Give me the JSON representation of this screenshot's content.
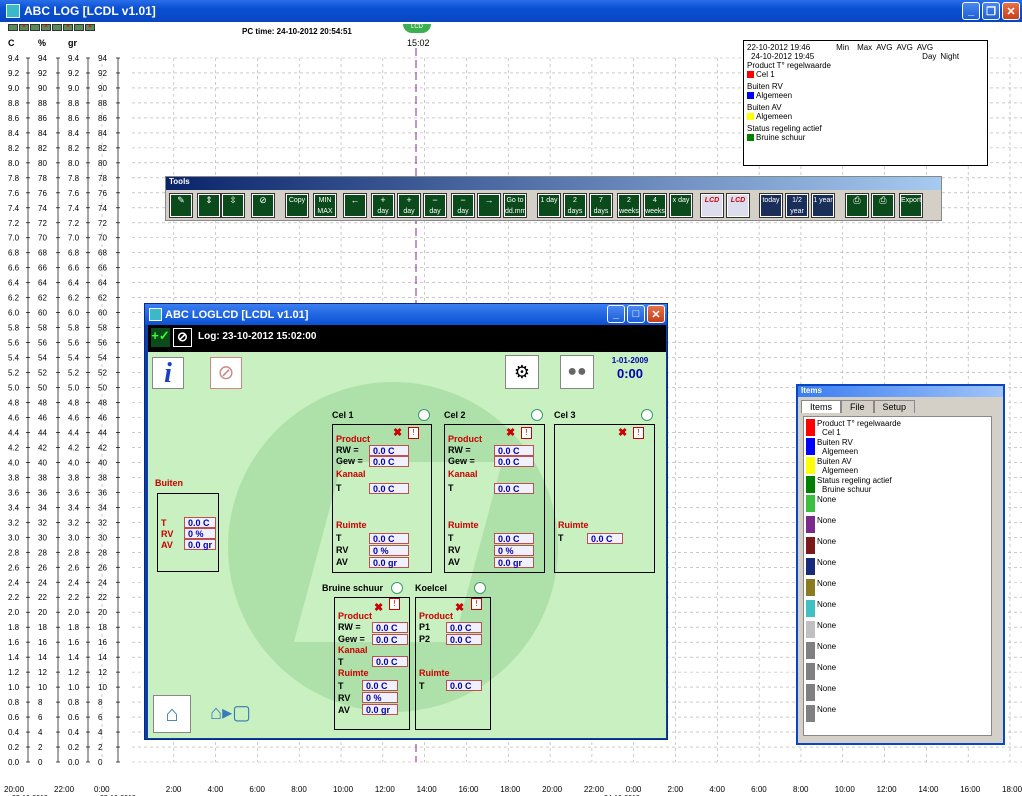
{
  "window": {
    "title": "ABC LOG [LCDL v1.01]"
  },
  "header": {
    "pc_time": "PC time: 24-10-2012 20:54:51",
    "lcd_mark": "LCD",
    "now_time": "15:02"
  },
  "axes": {
    "units": [
      "C",
      "%",
      "gr"
    ]
  },
  "chart_data": {
    "type": "line",
    "left_axes": [
      {
        "unit": "C",
        "ticks": [
          "9.4",
          "9.2",
          "9.0",
          "8.8",
          "8.6",
          "8.4",
          "8.2",
          "8.0",
          "7.8",
          "7.6",
          "7.4",
          "7.2",
          "7.0",
          "6.8",
          "6.6",
          "6.4",
          "6.2",
          "6.0",
          "5.8",
          "5.6",
          "5.4",
          "5.2",
          "5.0",
          "4.8",
          "4.6",
          "4.4",
          "4.2",
          "4.0",
          "3.8",
          "3.6",
          "3.4",
          "3.2",
          "3.0",
          "2.8",
          "2.6",
          "2.4",
          "2.2",
          "2.0",
          "1.8",
          "1.6",
          "1.4",
          "1.2",
          "1.0",
          "0.8",
          "0.6",
          "0.4",
          "0.2",
          "0.0"
        ]
      },
      {
        "unit": "%",
        "ticks": [
          "94",
          "92",
          "90",
          "88",
          "86",
          "84",
          "82",
          "80",
          "78",
          "76",
          "74",
          "72",
          "70",
          "68",
          "66",
          "64",
          "62",
          "60",
          "58",
          "56",
          "54",
          "52",
          "50",
          "48",
          "46",
          "44",
          "42",
          "40",
          "38",
          "36",
          "34",
          "32",
          "30",
          "28",
          "26",
          "24",
          "22",
          "20",
          "18",
          "16",
          "14",
          "12",
          "10",
          "8",
          "6",
          "4",
          "2",
          "0"
        ]
      }
    ],
    "x_ticks": [
      "20:00",
      "22:00",
      "0:00",
      "2:00",
      "4:00",
      "6:00",
      "8:00",
      "10:00",
      "12:00",
      "14:00",
      "16:00",
      "18:00",
      "20:00",
      "22:00",
      "0:00",
      "2:00",
      "4:00",
      "6:00",
      "8:00",
      "10:00",
      "12:00",
      "14:00",
      "16:00",
      "18:00"
    ],
    "x_dates": [
      {
        "at": "20:00",
        "label": "22-10-2012"
      },
      {
        "at": "0:00",
        "label": "23-10-2012"
      },
      {
        "at": "0:00",
        "label": "24-10-2012"
      }
    ],
    "cursor_time": "15:02",
    "grid": true,
    "series": []
  },
  "legend": {
    "range1": "22-10-2012 19:46",
    "range2": "24-10-2012 19:45",
    "cols": [
      "Min",
      "Max",
      "AVG",
      "AVG",
      "AVG"
    ],
    "cols2": [
      "Day",
      "Night"
    ],
    "entries": [
      {
        "title": "Product T° regelwaarde",
        "name": "Cel 1",
        "color": "#ff0000"
      },
      {
        "title": "Buiten RV",
        "name": "Algemeen",
        "color": "#0000ff"
      },
      {
        "title": "Buiten AV",
        "name": "Algemeen",
        "color": "#ffff00"
      },
      {
        "title": "Status regeling actief",
        "name": "Bruine schuur",
        "color": "#008000"
      }
    ]
  },
  "tools": {
    "title": "Tools",
    "buttons": [
      {
        "label": "",
        "icon": "edit-icon"
      },
      {
        "label": "",
        "icon": "scale-up-icon"
      },
      {
        "label": "",
        "icon": "scale-icon"
      },
      {
        "label": "",
        "icon": "cancel-icon"
      },
      {
        "label": "Copy",
        "icon": "copy-icon"
      },
      {
        "label": "MIN MAX",
        "icon": "minmax-icon"
      },
      {
        "label": "",
        "icon": "arrow-left-icon"
      },
      {
        "label": "day",
        "icon": "plus-day-icon"
      },
      {
        "label": "day",
        "icon": "plus-icon"
      },
      {
        "label": "day",
        "icon": "minus-icon"
      },
      {
        "label": "day",
        "icon": "minus-day-icon"
      },
      {
        "label": "",
        "icon": "arrow-right-icon"
      },
      {
        "label": "Go to dd.mm",
        "icon": "goto-icon"
      },
      {
        "label": "1 day",
        "icon": "day1-icon"
      },
      {
        "label": "2 days",
        "icon": "day2-icon"
      },
      {
        "label": "7 days",
        "icon": "day7-icon"
      },
      {
        "label": "2 weeks",
        "icon": "week2-icon"
      },
      {
        "label": "4 weeks",
        "icon": "week4-icon"
      },
      {
        "label": "x day",
        "icon": "xday-icon"
      },
      {
        "label": "LCD",
        "icon": "lcd-icon"
      },
      {
        "label": "LCD",
        "icon": "lcd-play-icon"
      },
      {
        "label": "today",
        "icon": "today-icon"
      },
      {
        "label": "1/2 year",
        "icon": "halfyear-icon"
      },
      {
        "label": "1 year",
        "icon": "year-icon"
      },
      {
        "label": "",
        "icon": "print-icon"
      },
      {
        "label": "",
        "icon": "print-red-icon"
      },
      {
        "label": "Export",
        "icon": "export-icon"
      }
    ]
  },
  "lcd": {
    "title": "ABC LOGLCD [LCDL v1.01]",
    "log": "Log: 23-10-2012 15:02:00",
    "date": "1-01-2009",
    "time": "0:00",
    "buiten": {
      "title": "Buiten",
      "T": "0.0 C",
      "RV": "0 %",
      "AV": "0.0 gr"
    },
    "cel1": {
      "title": "Cel 1",
      "rw": "0.0 C",
      "gew": "0.0 C",
      "kanaal_t": "0.0 C",
      "t": "0.0 C",
      "rv": "0 %",
      "av": "0.0 gr"
    },
    "cel2": {
      "title": "Cel 2",
      "rw": "0.0 C",
      "gew": "0.0 C",
      "kanaal_t": "0.0 C",
      "t": "0.0 C",
      "rv": "0 %",
      "av": "0.0 gr"
    },
    "cel3": {
      "title": "Cel 3",
      "t": "0.0 C"
    },
    "bruine": {
      "title": "Bruine schuur",
      "rw": "0.0 C",
      "gew": "0.0 C",
      "kanaal_t": "0.0 C",
      "t": "0.0 C",
      "rv": "0 %",
      "av": "0.0 gr"
    },
    "koelcel": {
      "title": "Koelcel",
      "p1": "0.0 C",
      "p2": "0.0 C",
      "t": "0.0 C"
    },
    "labels": {
      "product": "Product",
      "kanaal": "Kanaal",
      "ruimte": "Ruimte",
      "rw": "RW =",
      "gew": "Gew =",
      "T": "T",
      "RV": "RV",
      "AV": "AV",
      "P1": "P1",
      "P2": "P2"
    }
  },
  "items_panel": {
    "title": "Items",
    "tabs": [
      "Items",
      "File",
      "Setup"
    ],
    "entries": [
      {
        "line1": "Product T° regelwaarde",
        "line2": "Cel 1",
        "color": "#ff0000"
      },
      {
        "line1": "Buiten RV",
        "line2": "Algemeen",
        "color": "#0000ff"
      },
      {
        "line1": "Buiten AV",
        "line2": "Algemeen",
        "color": "#ffff00"
      },
      {
        "line1": "Status regeling actief",
        "line2": "Bruine schuur",
        "color": "#008000"
      },
      {
        "line1": "None",
        "line2": "",
        "color": "#3cc040"
      },
      {
        "line1": "None",
        "line2": "",
        "color": "#7a2a8a"
      },
      {
        "line1": "None",
        "line2": "",
        "color": "#7a1a1a"
      },
      {
        "line1": "None",
        "line2": "",
        "color": "#1a2a7a"
      },
      {
        "line1": "None",
        "line2": "",
        "color": "#8a7a20"
      },
      {
        "line1": "None",
        "line2": "",
        "color": "#40c0c0"
      },
      {
        "line1": "None",
        "line2": "",
        "color": "#c0c0c0"
      },
      {
        "line1": "None",
        "line2": "",
        "color": "#808080"
      },
      {
        "line1": "None",
        "line2": "",
        "color": "#808080"
      },
      {
        "line1": "None",
        "line2": "",
        "color": "#808080"
      },
      {
        "line1": "None",
        "line2": "",
        "color": "#808080"
      }
    ]
  }
}
